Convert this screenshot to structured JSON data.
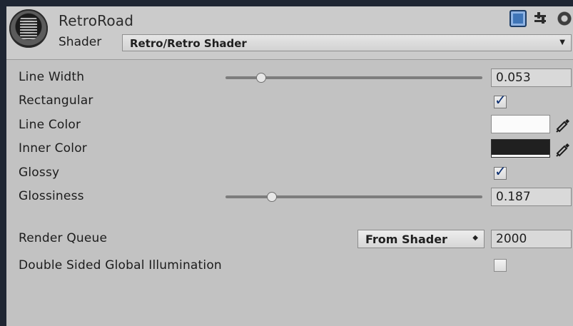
{
  "header": {
    "title": "RetroRoad",
    "shader_label": "Shader",
    "shader_value": "Retro/Retro Shader",
    "icons": [
      "help-icon",
      "settings-sliders-icon",
      "gear-icon"
    ]
  },
  "properties": [
    {
      "label": "Line Width",
      "type": "slider",
      "value": "0.053",
      "position": 0.14
    },
    {
      "label": "Rectangular",
      "type": "checkbox",
      "checked": true
    },
    {
      "label": "Line Color",
      "type": "color",
      "color": "#FFFFFF"
    },
    {
      "label": "Inner Color",
      "type": "color",
      "color": "#202020"
    },
    {
      "label": "Glossy",
      "type": "checkbox",
      "checked": true
    },
    {
      "label": "Glossiness",
      "type": "slider",
      "value": "0.187",
      "position": 0.18
    }
  ],
  "render_queue": {
    "label": "Render Queue",
    "dropdown_value": "From Shader",
    "value": "2000"
  },
  "gi": {
    "label": "Double Sided Global Illumination",
    "checked": false
  }
}
